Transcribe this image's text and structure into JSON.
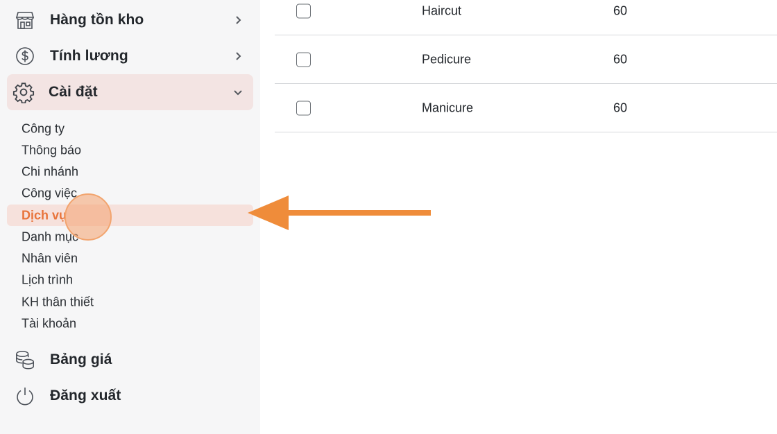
{
  "sidebar": {
    "items": [
      {
        "label": "Hàng tồn kho",
        "icon": "store-icon",
        "expandable": true
      },
      {
        "label": "Tính lương",
        "icon": "dollar-circle-icon",
        "expandable": true
      },
      {
        "label": "Cài đặt",
        "icon": "gear-icon",
        "expanded": true
      },
      {
        "label": "Bảng giá",
        "icon": "coins-icon"
      },
      {
        "label": "Đăng xuất",
        "icon": "power-icon"
      }
    ],
    "settings_submenu": [
      "Công ty",
      "Thông báo",
      "Chi nhánh",
      "Công việc",
      "Dịch vụ",
      "Danh mục",
      "Nhân viên",
      "Lịch trình",
      "KH thân thiết",
      "Tài khoản"
    ],
    "active_submenu": "Dịch vụ"
  },
  "services_table": {
    "rows": [
      {
        "name": "Haircut",
        "duration": "60"
      },
      {
        "name": "Pedicure",
        "duration": "60"
      },
      {
        "name": "Manicure",
        "duration": "60"
      }
    ]
  },
  "colors": {
    "accent": "#e8743b",
    "arrow": "#ef8c3a",
    "sidebar_bg": "#f6f6f7",
    "open_item_bg": "#f3e4e3"
  }
}
